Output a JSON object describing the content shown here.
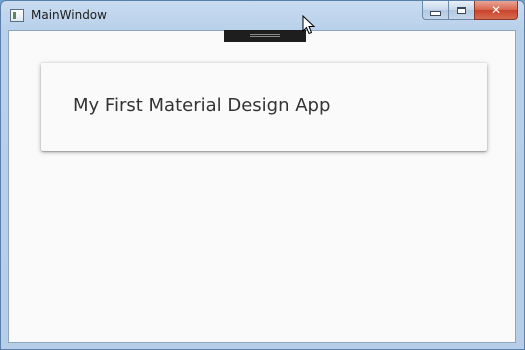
{
  "window": {
    "title": "MainWindow"
  },
  "card": {
    "title": "My First Material Design App"
  },
  "icons": {
    "app": "window-icon",
    "minimize": "minimize-icon",
    "maximize": "maximize-icon",
    "close": "close-icon",
    "cursor": "mouse-cursor-icon"
  },
  "colors": {
    "client_background": "#fafafa",
    "card_text": "#333333",
    "close_button": "#c8432a"
  }
}
